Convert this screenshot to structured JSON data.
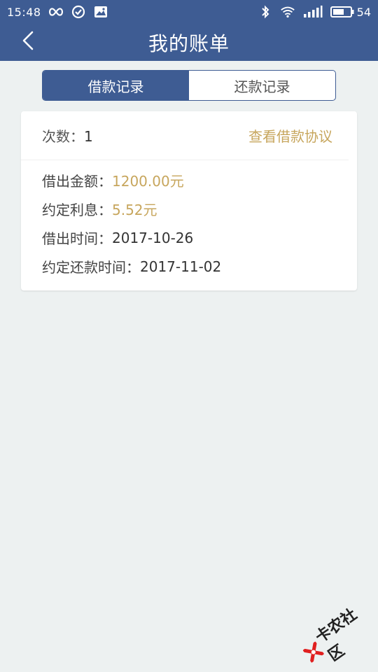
{
  "status_bar": {
    "time": "15:48",
    "battery": "54",
    "icons": [
      "infinity-icon",
      "check-circle-icon",
      "image-icon",
      "bluetooth-icon",
      "wifi-icon",
      "signal-icon",
      "battery-icon"
    ]
  },
  "header": {
    "title": "我的账单",
    "back_icon": "chevron-left-icon"
  },
  "tabs": [
    {
      "label": "借款记录",
      "active": true
    },
    {
      "label": "还款记录",
      "active": false
    }
  ],
  "record": {
    "count_label": "次数：",
    "count_value": "1",
    "agreement_link": "查看借款协议",
    "rows": [
      {
        "label": "借出金额：",
        "value": "1200.00元",
        "highlight": true
      },
      {
        "label": "约定利息：",
        "value": "5.52元",
        "highlight": true
      },
      {
        "label": "借出时间：",
        "value": "2017-10-26",
        "highlight": false
      },
      {
        "label": "约定还款时间：",
        "value": "2017-11-02",
        "highlight": false
      }
    ]
  },
  "watermark": {
    "text": "卡农社区"
  },
  "colors": {
    "primary": "#3e5c93",
    "accent_gold": "#c7a65d",
    "background": "#edf1f1",
    "watermark_red": "#e02020"
  }
}
